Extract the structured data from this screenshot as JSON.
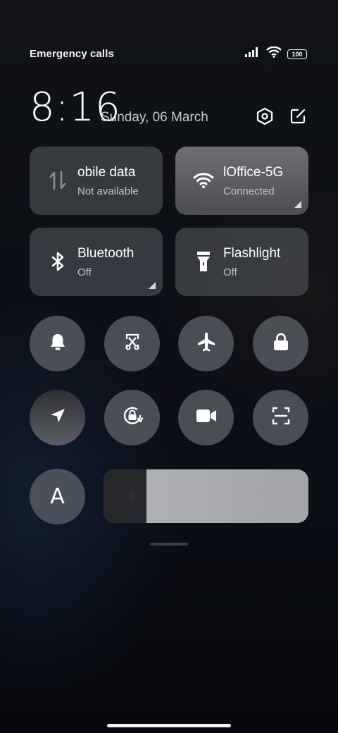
{
  "status_bar": {
    "carrier_text": "Emergency calls o",
    "battery_level": "100"
  },
  "header": {
    "time": "8:16",
    "date": "Sunday, 06 March"
  },
  "tiles": [
    {
      "title": "obile data",
      "subtitle": "Not available"
    },
    {
      "title": "lOffice-5G",
      "subtitle": "Connected"
    },
    {
      "title": "Bluetooth",
      "subtitle": "Off"
    },
    {
      "title": "Flashlight",
      "subtitle": "Off"
    }
  ],
  "auto_brightness_label": "A",
  "brightness": {
    "level_fraction": 0.79
  },
  "icons": [
    "settings-hex-icon",
    "edit-icon",
    "mobile-data-icon",
    "wifi-icon",
    "bluetooth-icon",
    "flashlight-icon",
    "bell-icon",
    "screenshot-scissors-icon",
    "airplane-icon",
    "lock-icon",
    "location-icon",
    "rotation-lock-icon",
    "video-camera-icon",
    "scan-icon",
    "sun-icon"
  ]
}
